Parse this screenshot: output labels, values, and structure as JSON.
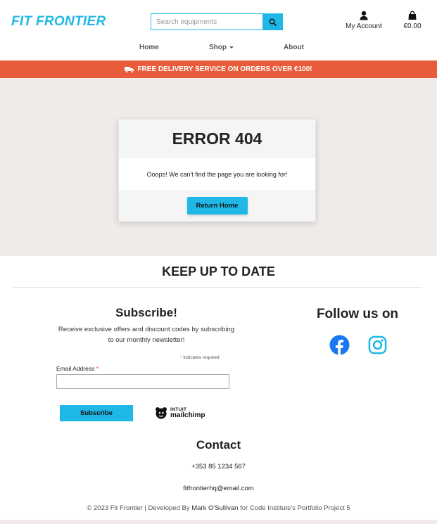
{
  "header": {
    "logo": "FIT FRONTIER",
    "search": {
      "placeholder": "Search equipments"
    },
    "account_label": "My Account",
    "cart_total": "€0.00"
  },
  "nav": {
    "home": "Home",
    "shop": "Shop",
    "about": "About"
  },
  "banner": {
    "text": "FREE DELIVERY SERVICE ON ORDERS OVER €100!"
  },
  "error_card": {
    "title": "ERROR 404",
    "message": "Ooops! We can't find the page you are looking for!",
    "button": "Return Home"
  },
  "footer": {
    "heading": "KEEP UP TO DATE",
    "subscribe": {
      "title": "Subscribe!",
      "text_line1": "Receive exclusive offers and discount codes by subscribing",
      "text_line2": "to our monthly newsletter!",
      "required_star": "*",
      "required_note": " indicates required",
      "email_label": "Email Address ",
      "email_star": "*",
      "button": "Subscribe",
      "mailchimp_intuit": "INTUIT",
      "mailchimp_name": "mailchimp"
    },
    "follow_title": "Follow us on",
    "contact": {
      "title": "Contact",
      "phone": "+353 85 1234 567",
      "email": "fitfrontierhq@email.com"
    },
    "copyright_prefix": "© 2023 Fit Frontier | Developed By ",
    "developer": "Mark O'Sullivan",
    "copyright_suffix": " for Code Institute's Portfolio Project 5"
  },
  "colors": {
    "accent": "#1fb8e6",
    "banner": "#e85c3c",
    "main_bg": "#f0ebe8",
    "facebook": "#1877f2",
    "instagram": "#1fb8e6"
  },
  "icons": {
    "search": "search-icon",
    "account": "user-icon",
    "cart": "shopping-bag-icon",
    "truck": "truck-icon",
    "facebook": "facebook-icon",
    "instagram": "instagram-icon"
  }
}
